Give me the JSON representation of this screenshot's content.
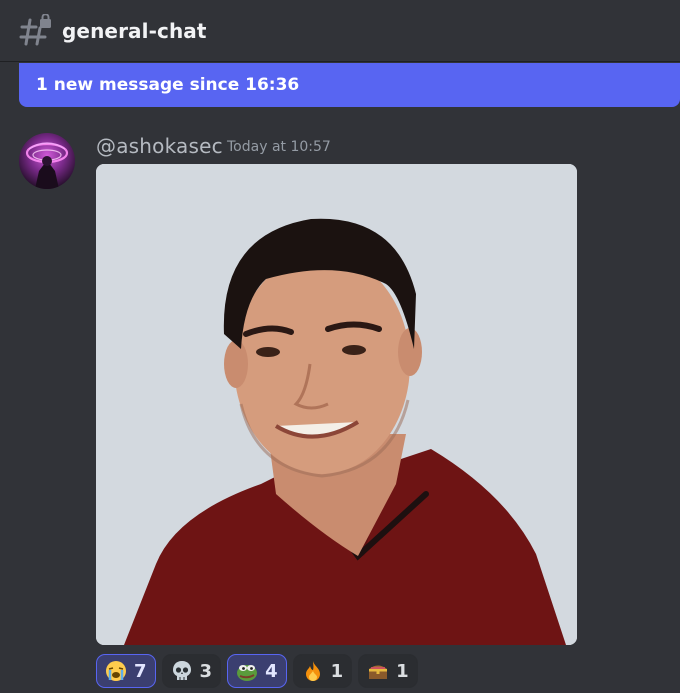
{
  "header": {
    "channel_icon": "locked-text-channel-icon",
    "channel_name": "general-chat"
  },
  "banner": {
    "text": "1 new message since 16:36"
  },
  "message": {
    "username": "@ashokasec",
    "timestamp": "Today at 10:57",
    "avatar_icon": "user-avatar",
    "attachment": "photo-of-man-in-maroon-shirt"
  },
  "reactions": [
    {
      "emoji": "loudly-crying-face",
      "count": "7",
      "me": true
    },
    {
      "emoji": "skull",
      "count": "3",
      "me": false
    },
    {
      "emoji": "pepe-frog",
      "count": "4",
      "me": true
    },
    {
      "emoji": "fire",
      "count": "1",
      "me": false
    },
    {
      "emoji": "treasure-chest",
      "count": "1",
      "me": false
    }
  ],
  "colors": {
    "background": "#313338",
    "banner": "#5865f2",
    "reaction_me_border": "#5865f2"
  }
}
